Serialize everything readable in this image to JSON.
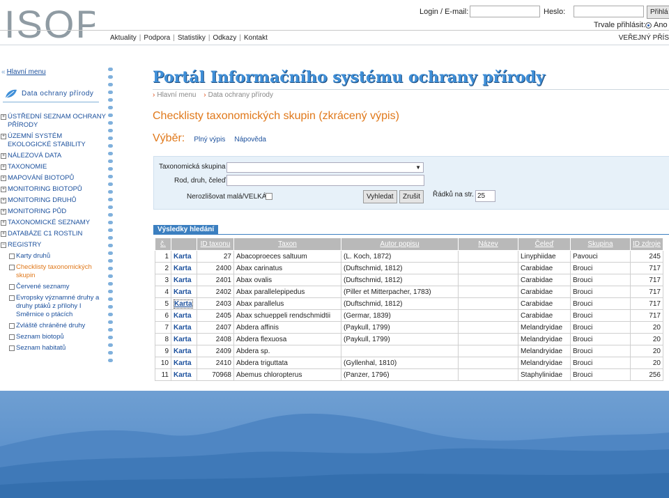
{
  "header": {
    "logo_text": "ISOP",
    "login_label": "Login / E-mail:",
    "password_label": "Heslo:",
    "login_button": "Přihlá",
    "remember_label": "Trvale přihlásit:",
    "remember_option": "Ano"
  },
  "topnav": {
    "items": [
      "Aktuality",
      "Podpora",
      "Statistiky",
      "Odkazy",
      "Kontakt"
    ],
    "public_label": "VEŘEJNÝ PŘÍS"
  },
  "sidebar": {
    "back_label": "Hlavní menu",
    "section_label": "Data ochrany přírody",
    "menu": [
      "ÚSTŘEDNÍ SEZNAM OCHRANY PŘÍRODY",
      "ÚZEMNÍ SYSTÉM EKOLOGICKÉ STABILITY",
      "NÁLEZOVÁ DATA",
      "TAXONOMIE",
      "MAPOVÁNÍ BIOTOPŮ",
      "MONITORING BIOTOPŮ",
      "MONITORING DRUHŮ",
      "MONITORING PŮD",
      "TAXONOMICKÉ SEZNAMY",
      "DATABÁZE C1 ROSTLIN",
      "REGISTRY"
    ],
    "submenu": [
      "Karty druhů",
      "Checklisty taxonomických skupin",
      "Červené seznamy",
      "Evropsky významné druhy a druhy ptáků z přílohy I Směrnice o ptácích",
      "Zvláště chráněné druhy",
      "Seznam biotopů",
      "Seznam habitatů"
    ]
  },
  "main": {
    "portal_title": "Portál Informačního systému ochrany přírody",
    "breadcrumb": [
      "Hlavní menu",
      "Data ochrany přírody"
    ],
    "content_title": "Checklisty taxonomických skupin (zkrácený výpis)",
    "vyber_label": "Výběr:",
    "links": [
      "Plný výpis",
      "Nápověda"
    ]
  },
  "form": {
    "group_label": "Taxonomická skupina",
    "name_label": "Rod, druh, čeleď",
    "case_label": "Nerozlišovat malá/VELKÁ",
    "search_button": "Vyhledat",
    "cancel_button": "Zrušit",
    "rows_label": "Řádků na str.",
    "rows_value": "25"
  },
  "results": {
    "tab_label": "Výsledky hledání",
    "columns": [
      "č.",
      "ID taxonu",
      "Taxon",
      "Autor popisu",
      "Název",
      "Čeleď",
      "Skupina",
      "ID zdroje"
    ],
    "rows": [
      [
        "1",
        "Karta",
        "27",
        "Abacoproeces saltuum",
        "(L. Koch, 1872)",
        "",
        "Linyphiidae",
        "Pavouci",
        "245"
      ],
      [
        "2",
        "Karta",
        "2400",
        "Abax carinatus",
        "(Duftschmid, 1812)",
        "",
        "Carabidae",
        "Brouci",
        "717"
      ],
      [
        "3",
        "Karta",
        "2401",
        "Abax ovalis",
        "(Duftschmid, 1812)",
        "",
        "Carabidae",
        "Brouci",
        "717"
      ],
      [
        "4",
        "Karta",
        "2402",
        "Abax parallelepipedus",
        "(Piller et Mitterpacher, 1783)",
        "",
        "Carabidae",
        "Brouci",
        "717"
      ],
      [
        "5",
        "Karta",
        "2403",
        "Abax parallelus",
        "(Duftschmid, 1812)",
        "",
        "Carabidae",
        "Brouci",
        "717"
      ],
      [
        "6",
        "Karta",
        "2405",
        "Abax schueppeli rendschmidtii",
        "(Germar, 1839)",
        "",
        "Carabidae",
        "Brouci",
        "717"
      ],
      [
        "7",
        "Karta",
        "2407",
        "Abdera affinis",
        "(Paykull, 1799)",
        "",
        "Melandryidae",
        "Brouci",
        "20"
      ],
      [
        "8",
        "Karta",
        "2408",
        "Abdera flexuosa",
        "(Paykull, 1799)",
        "",
        "Melandryidae",
        "Brouci",
        "20"
      ],
      [
        "9",
        "Karta",
        "2409",
        "Abdera sp.",
        "",
        "",
        "Melandryidae",
        "Brouci",
        "20"
      ],
      [
        "10",
        "Karta",
        "2410",
        "Abdera triguttata",
        "(Gyllenhal, 1810)",
        "",
        "Melandryidae",
        "Brouci",
        "20"
      ],
      [
        "11",
        "Karta",
        "70968",
        "Abemus chloropterus",
        "(Panzer, 1796)",
        "",
        "Staphylinidae",
        "Brouci",
        "256"
      ]
    ]
  },
  "colors": {
    "accent_orange": "#e0781a",
    "link_blue": "#1a4f9c",
    "title_blue": "#3f8fd8",
    "table_header": "#b9b9b9"
  }
}
